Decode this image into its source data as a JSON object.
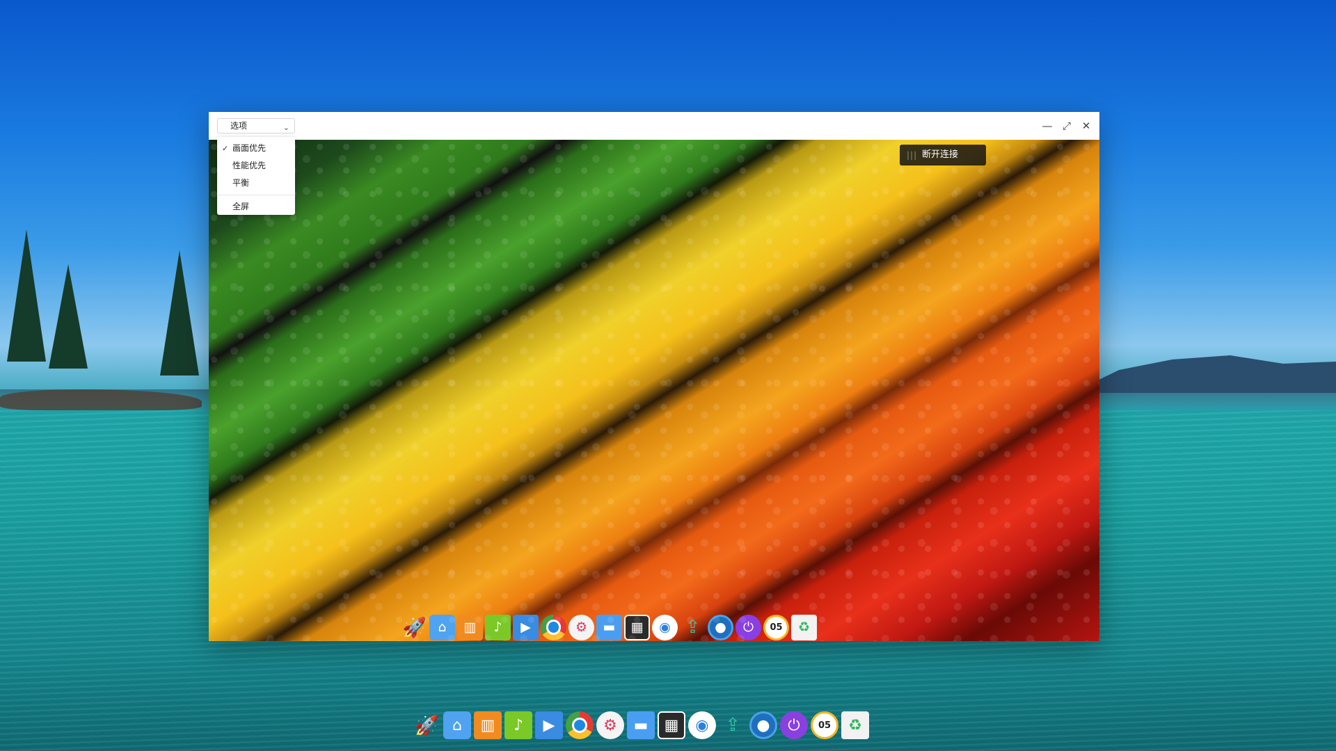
{
  "window": {
    "options_label": "选项",
    "controls": {
      "minimize_icon": "minimize-icon",
      "maximize_icon": "maximize-icon",
      "close_icon": "close-icon"
    }
  },
  "options_menu": {
    "items": [
      {
        "label": "画面优先",
        "checked": true
      },
      {
        "label": "性能优先",
        "checked": false
      },
      {
        "label": "平衡",
        "checked": false
      }
    ],
    "fullscreen_label": "全屏"
  },
  "remote": {
    "disconnect_label": "断开连接"
  },
  "dock": {
    "items": [
      {
        "name": "launcher",
        "icon": "rocket-icon",
        "glyph": "🚀"
      },
      {
        "name": "file-manager-home",
        "icon": "home-folder-icon",
        "glyph": "⌂"
      },
      {
        "name": "app-store",
        "icon": "store-bag-icon",
        "glyph": "▥"
      },
      {
        "name": "music",
        "icon": "music-icon",
        "glyph": "♪"
      },
      {
        "name": "video",
        "icon": "video-icon",
        "glyph": "▶"
      },
      {
        "name": "chrome",
        "icon": "chrome-icon",
        "glyph": ""
      },
      {
        "name": "settings",
        "icon": "gear-icon",
        "glyph": "⚙"
      },
      {
        "name": "folder",
        "icon": "folder-icon",
        "glyph": "▬"
      },
      {
        "name": "remote-desktop",
        "icon": "monitor-icon",
        "glyph": "▦"
      },
      {
        "name": "network",
        "icon": "wifi-icon",
        "glyph": "◉"
      },
      {
        "name": "usb",
        "icon": "usb-icon",
        "glyph": "⇪"
      },
      {
        "name": "qq",
        "icon": "qq-icon",
        "glyph": "●"
      },
      {
        "name": "power",
        "icon": "power-icon",
        "glyph": "⏻"
      },
      {
        "name": "clock",
        "icon": "clock-icon",
        "glyph": "05"
      },
      {
        "name": "trash",
        "icon": "trash-icon",
        "glyph": "♻"
      }
    ]
  },
  "colors": {
    "window_bg": "#ffffff",
    "disconnect_bg": "#141414",
    "dock_power": "#8a3fe0"
  }
}
